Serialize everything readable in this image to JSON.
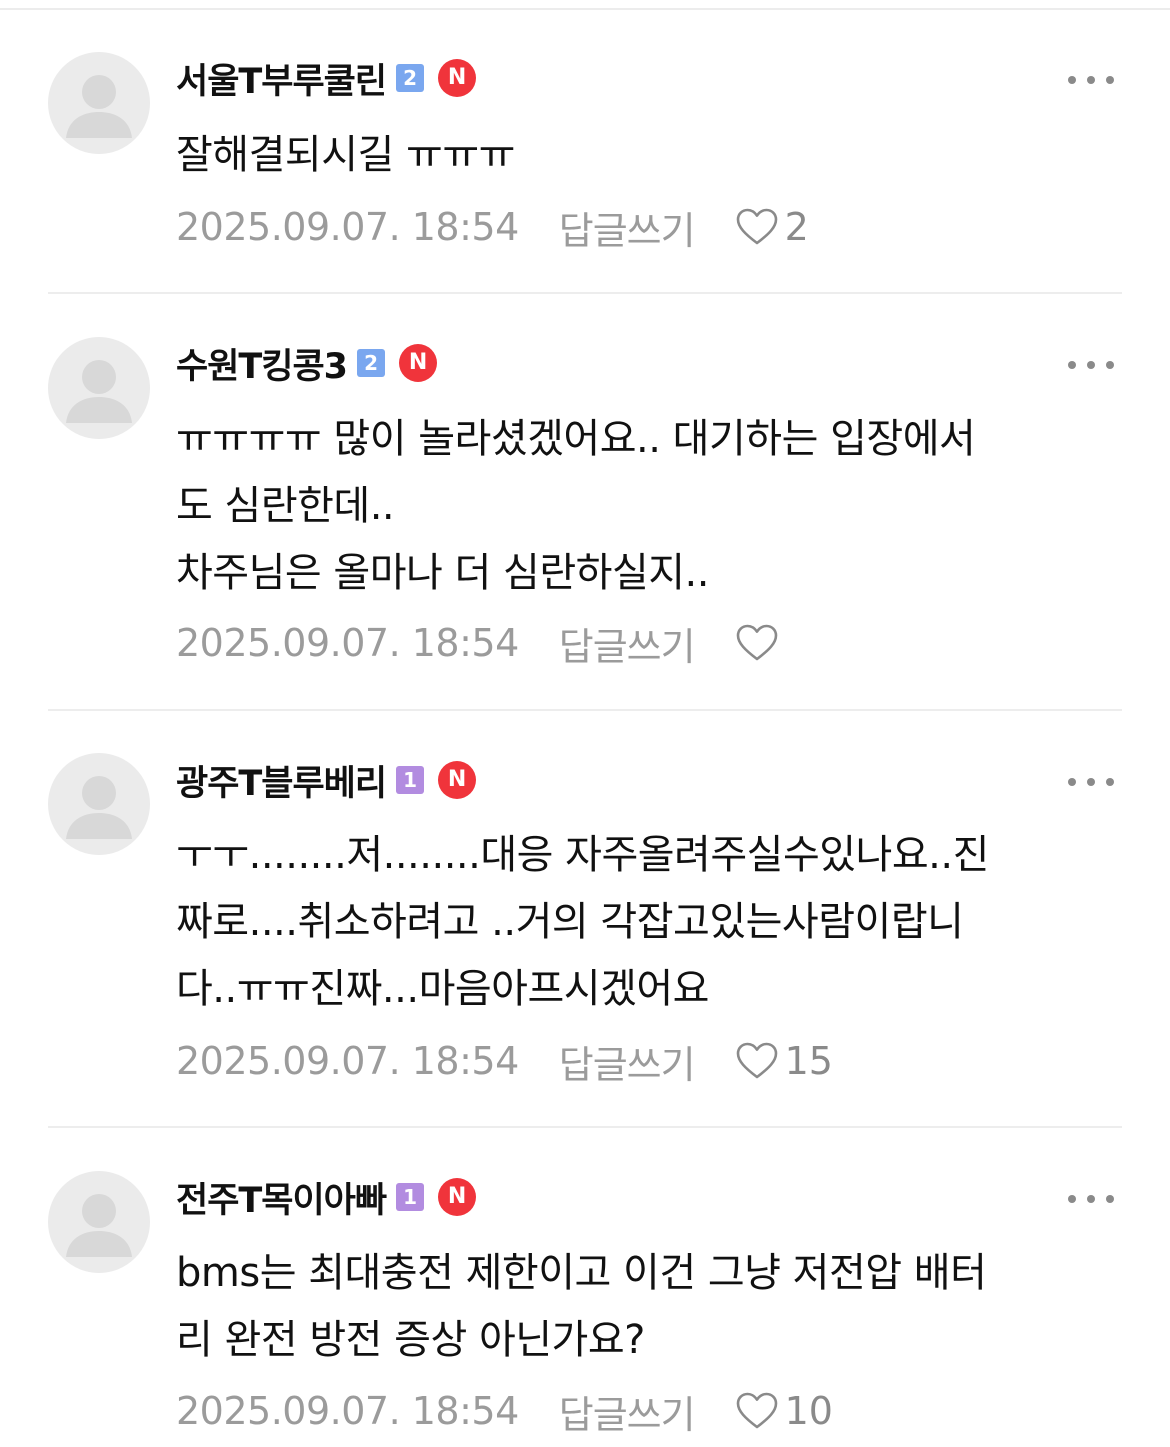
{
  "comments": [
    {
      "nickname": "서울T부루쿨린",
      "level": "2",
      "badge": "N",
      "text": "잘해결되시길 ㅠㅠㅠ",
      "date": "2025.09.07. 18:54",
      "reply_label": "답글쓰기",
      "likes": "2"
    },
    {
      "nickname": "수원T킹콩3",
      "level": "2",
      "badge": "N",
      "text": "ㅠㅠㅠㅠ 많이 놀라셨겠어요.. 대기하는 입장에서\n도 심란한데..\n차주님은 올마나 더 심란하실지..",
      "date": "2025.09.07. 18:54",
      "reply_label": "답글쓰기",
      "likes": ""
    },
    {
      "nickname": "광주T블루베리",
      "level": "1",
      "badge": "N",
      "text": "ㅜㅜ........저........대응 자주올려주실수있나요..진\n짜로....취소하려고 ..거의 각잡고있는사람이랍니\n다..ㅠㅠ진짜...마음아프시겠어요",
      "date": "2025.09.07. 18:54",
      "reply_label": "답글쓰기",
      "likes": "15"
    },
    {
      "nickname": "전주T목이아빠",
      "level": "1",
      "badge": "N",
      "text": "bms는 최대충전 제한이고 이건 그냥 저전압 배터\n리 완전 방전 증상 아닌가요?",
      "date": "2025.09.07. 18:54",
      "reply_label": "답글쓰기",
      "likes": "10"
    }
  ],
  "icons": {
    "avatar": "default-user-avatar-icon",
    "more": "more-dots-icon",
    "like": "heart-outline-icon"
  },
  "colors": {
    "level_2": "#7aa7ef",
    "level_1": "#b28ce0",
    "new_badge": "#f0343b",
    "meta_text": "#9b9b9b"
  }
}
